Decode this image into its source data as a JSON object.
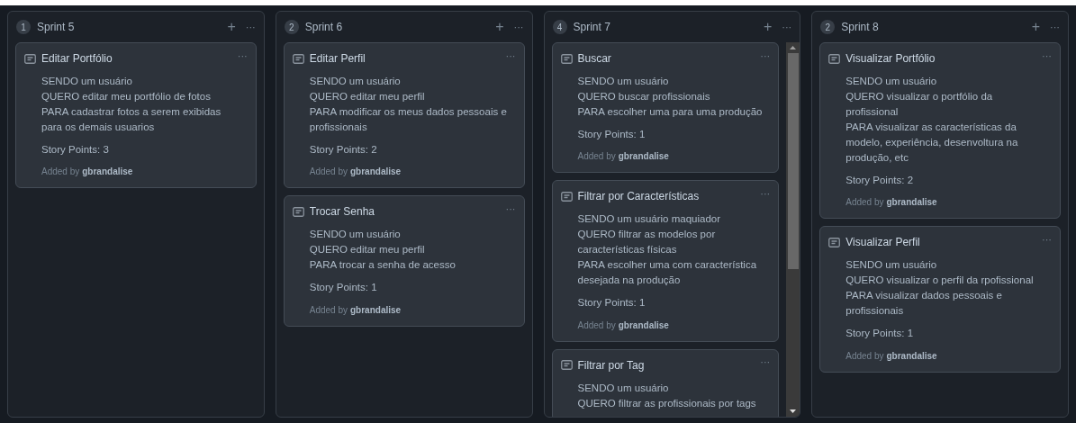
{
  "columns": [
    {
      "count": "1",
      "title": "Sprint 5",
      "add": "+",
      "menu": "···",
      "scrollable": false,
      "cards": [
        {
          "title": "Editar Portfólio",
          "menu": "···",
          "lines": [
            "SENDO um usuário",
            "QUERO editar meu portfólio de fotos",
            "PARA cadastrar fotos a serem exibidas para os demais usuarios"
          ],
          "points": "Story Points: 3",
          "added_by": "Added by",
          "author": "gbrandalise"
        }
      ]
    },
    {
      "count": "2",
      "title": "Sprint 6",
      "add": "+",
      "menu": "···",
      "scrollable": false,
      "cards": [
        {
          "title": "Editar Perfil",
          "menu": "···",
          "lines": [
            "SENDO um usuário",
            "QUERO editar meu perfil",
            "PARA modificar os meus dados pessoais e profissionais"
          ],
          "points": "Story Points: 2",
          "added_by": "Added by",
          "author": "gbrandalise"
        },
        {
          "title": "Trocar Senha",
          "menu": "···",
          "lines": [
            "SENDO um usuário",
            "QUERO editar meu perfil",
            "PARA trocar a senha de acesso"
          ],
          "points": "Story Points: 1",
          "added_by": "Added by",
          "author": "gbrandalise"
        }
      ]
    },
    {
      "count": "4",
      "title": "Sprint 7",
      "add": "+",
      "menu": "···",
      "scrollable": true,
      "cards": [
        {
          "title": "Buscar",
          "menu": "···",
          "lines": [
            "SENDO um usuário",
            "QUERO buscar profissionais",
            "PARA escolher uma para uma produção"
          ],
          "points": "Story Points: 1",
          "added_by": "Added by",
          "author": "gbrandalise"
        },
        {
          "title": "Filtrar por Características",
          "menu": "···",
          "lines": [
            "SENDO um usuário maquiador",
            "QUERO filtrar as modelos por características físicas",
            "PARA escolher uma com característica desejada na produção"
          ],
          "points": "Story Points: 1",
          "added_by": "Added by",
          "author": "gbrandalise"
        },
        {
          "title": "Filtrar por Tag",
          "menu": "···",
          "lines": [
            "SENDO um usuário",
            "QUERO filtrar as profissionais por tags"
          ]
        }
      ]
    },
    {
      "count": "2",
      "title": "Sprint 8",
      "add": "+",
      "menu": "···",
      "scrollable": false,
      "cards": [
        {
          "title": "Visualizar Portfólio",
          "menu": "···",
          "lines": [
            "SENDO um usuário",
            "QUERO visualizar o portfólio da profissional",
            "PARA visualizar as características da modelo, experiência, desenvoltura na produção, etc"
          ],
          "points": "Story Points: 2",
          "added_by": "Added by",
          "author": "gbrandalise"
        },
        {
          "title": "Visualizar Perfil",
          "menu": "···",
          "lines": [
            "SENDO um usuário",
            "QUERO visualizar o perfil da rpofissional",
            "PARA visualizar dados pessoais e profissionais"
          ],
          "points": "Story Points: 1",
          "added_by": "Added by",
          "author": "gbrandalise"
        }
      ]
    }
  ]
}
